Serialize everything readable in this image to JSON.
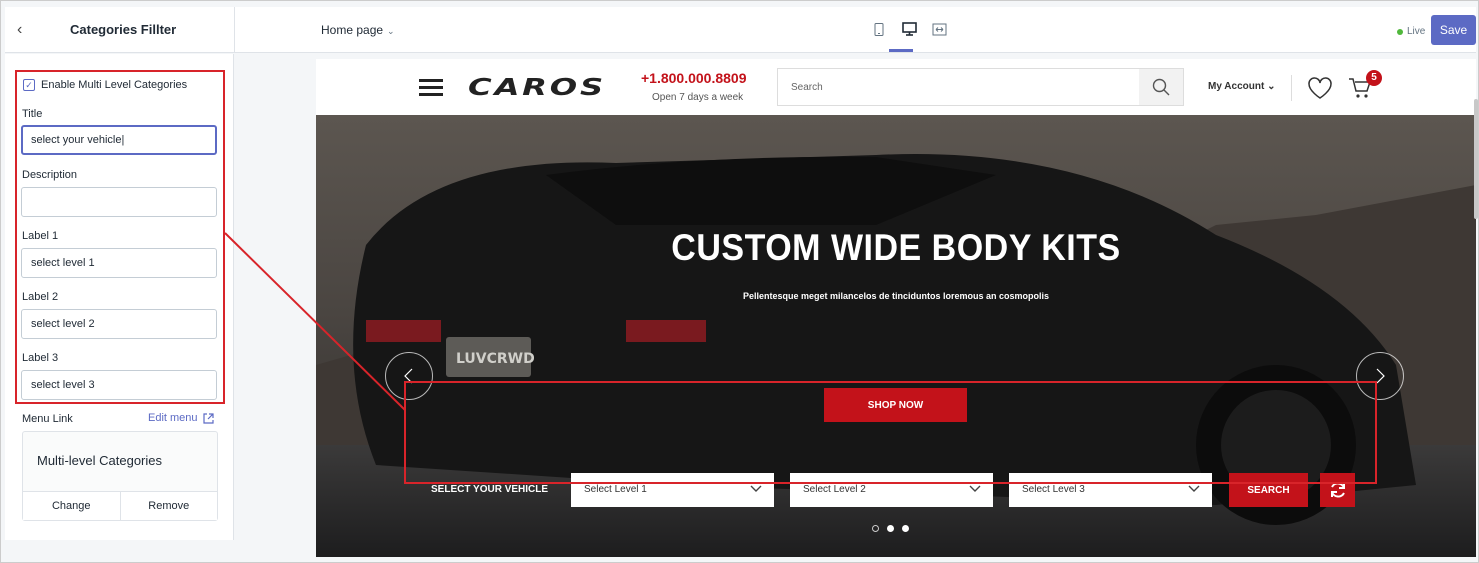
{
  "topbar": {
    "panel_title": "Categories Fillter",
    "page_selector": "Home page",
    "status": "Live",
    "save_label": "Save"
  },
  "sidebar": {
    "enable_label": "Enable Multi Level Categories",
    "title_label": "Title",
    "title_value": "select your vehicle",
    "description_label": "Description",
    "description_value": "",
    "label1_label": "Label 1",
    "label1_value": "select level 1",
    "label2_label": "Label 2",
    "label2_value": "select level 2",
    "label3_label": "Label 3",
    "label3_value": "select level 3",
    "menu_link_label": "Menu Link",
    "edit_menu_label": "Edit menu",
    "menu_name": "Multi-level Categories",
    "change_label": "Change",
    "remove_label": "Remove"
  },
  "site": {
    "logo_text": "CAROS",
    "phone": "+1.800.000.8809",
    "phone_sub": "Open 7 days a week",
    "search_placeholder": "Search",
    "account_label": "My Account",
    "cart_count": "5"
  },
  "hero": {
    "title": "CUSTOM WIDE BODY KITS",
    "subtitle": "Pellentesque meget milancelos de tinciduntos loremous an cosmopolis",
    "cta": "SHOP NOW",
    "plate_text": "LUVCRWD"
  },
  "vehicle_filter": {
    "label": "SELECT YOUR VEHICLE",
    "level1": "Select Level 1",
    "level2": "Select Level 2",
    "level3": "Select Level 3",
    "search_label": "SEARCH"
  },
  "colors": {
    "accent": "#5c6ac4",
    "brand_red": "#c3121a",
    "annotation_red": "#d8242a"
  }
}
